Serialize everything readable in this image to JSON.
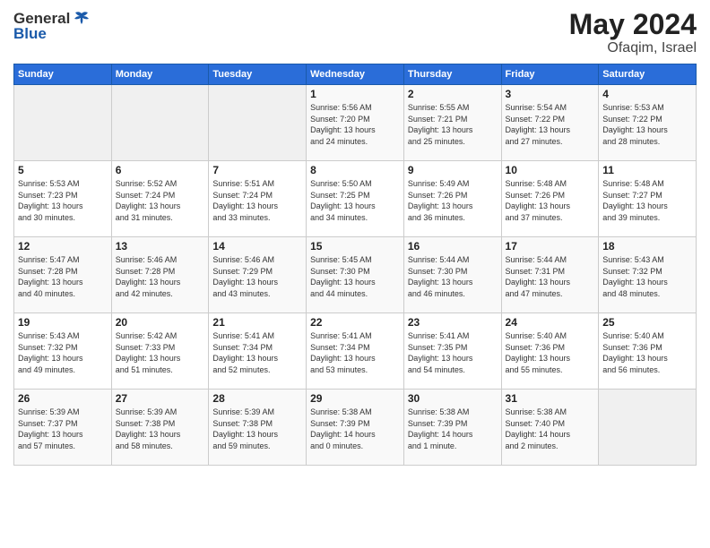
{
  "header": {
    "logo_general": "General",
    "logo_blue": "Blue",
    "month_year": "May 2024",
    "location": "Ofaqim, Israel"
  },
  "weekdays": [
    "Sunday",
    "Monday",
    "Tuesday",
    "Wednesday",
    "Thursday",
    "Friday",
    "Saturday"
  ],
  "weeks": [
    [
      {
        "day": "",
        "content": ""
      },
      {
        "day": "",
        "content": ""
      },
      {
        "day": "",
        "content": ""
      },
      {
        "day": "1",
        "content": "Sunrise: 5:56 AM\nSunset: 7:20 PM\nDaylight: 13 hours\nand 24 minutes."
      },
      {
        "day": "2",
        "content": "Sunrise: 5:55 AM\nSunset: 7:21 PM\nDaylight: 13 hours\nand 25 minutes."
      },
      {
        "day": "3",
        "content": "Sunrise: 5:54 AM\nSunset: 7:22 PM\nDaylight: 13 hours\nand 27 minutes."
      },
      {
        "day": "4",
        "content": "Sunrise: 5:53 AM\nSunset: 7:22 PM\nDaylight: 13 hours\nand 28 minutes."
      }
    ],
    [
      {
        "day": "5",
        "content": "Sunrise: 5:53 AM\nSunset: 7:23 PM\nDaylight: 13 hours\nand 30 minutes."
      },
      {
        "day": "6",
        "content": "Sunrise: 5:52 AM\nSunset: 7:24 PM\nDaylight: 13 hours\nand 31 minutes."
      },
      {
        "day": "7",
        "content": "Sunrise: 5:51 AM\nSunset: 7:24 PM\nDaylight: 13 hours\nand 33 minutes."
      },
      {
        "day": "8",
        "content": "Sunrise: 5:50 AM\nSunset: 7:25 PM\nDaylight: 13 hours\nand 34 minutes."
      },
      {
        "day": "9",
        "content": "Sunrise: 5:49 AM\nSunset: 7:26 PM\nDaylight: 13 hours\nand 36 minutes."
      },
      {
        "day": "10",
        "content": "Sunrise: 5:48 AM\nSunset: 7:26 PM\nDaylight: 13 hours\nand 37 minutes."
      },
      {
        "day": "11",
        "content": "Sunrise: 5:48 AM\nSunset: 7:27 PM\nDaylight: 13 hours\nand 39 minutes."
      }
    ],
    [
      {
        "day": "12",
        "content": "Sunrise: 5:47 AM\nSunset: 7:28 PM\nDaylight: 13 hours\nand 40 minutes."
      },
      {
        "day": "13",
        "content": "Sunrise: 5:46 AM\nSunset: 7:28 PM\nDaylight: 13 hours\nand 42 minutes."
      },
      {
        "day": "14",
        "content": "Sunrise: 5:46 AM\nSunset: 7:29 PM\nDaylight: 13 hours\nand 43 minutes."
      },
      {
        "day": "15",
        "content": "Sunrise: 5:45 AM\nSunset: 7:30 PM\nDaylight: 13 hours\nand 44 minutes."
      },
      {
        "day": "16",
        "content": "Sunrise: 5:44 AM\nSunset: 7:30 PM\nDaylight: 13 hours\nand 46 minutes."
      },
      {
        "day": "17",
        "content": "Sunrise: 5:44 AM\nSunset: 7:31 PM\nDaylight: 13 hours\nand 47 minutes."
      },
      {
        "day": "18",
        "content": "Sunrise: 5:43 AM\nSunset: 7:32 PM\nDaylight: 13 hours\nand 48 minutes."
      }
    ],
    [
      {
        "day": "19",
        "content": "Sunrise: 5:43 AM\nSunset: 7:32 PM\nDaylight: 13 hours\nand 49 minutes."
      },
      {
        "day": "20",
        "content": "Sunrise: 5:42 AM\nSunset: 7:33 PM\nDaylight: 13 hours\nand 51 minutes."
      },
      {
        "day": "21",
        "content": "Sunrise: 5:41 AM\nSunset: 7:34 PM\nDaylight: 13 hours\nand 52 minutes."
      },
      {
        "day": "22",
        "content": "Sunrise: 5:41 AM\nSunset: 7:34 PM\nDaylight: 13 hours\nand 53 minutes."
      },
      {
        "day": "23",
        "content": "Sunrise: 5:41 AM\nSunset: 7:35 PM\nDaylight: 13 hours\nand 54 minutes."
      },
      {
        "day": "24",
        "content": "Sunrise: 5:40 AM\nSunset: 7:36 PM\nDaylight: 13 hours\nand 55 minutes."
      },
      {
        "day": "25",
        "content": "Sunrise: 5:40 AM\nSunset: 7:36 PM\nDaylight: 13 hours\nand 56 minutes."
      }
    ],
    [
      {
        "day": "26",
        "content": "Sunrise: 5:39 AM\nSunset: 7:37 PM\nDaylight: 13 hours\nand 57 minutes."
      },
      {
        "day": "27",
        "content": "Sunrise: 5:39 AM\nSunset: 7:38 PM\nDaylight: 13 hours\nand 58 minutes."
      },
      {
        "day": "28",
        "content": "Sunrise: 5:39 AM\nSunset: 7:38 PM\nDaylight: 13 hours\nand 59 minutes."
      },
      {
        "day": "29",
        "content": "Sunrise: 5:38 AM\nSunset: 7:39 PM\nDaylight: 14 hours\nand 0 minutes."
      },
      {
        "day": "30",
        "content": "Sunrise: 5:38 AM\nSunset: 7:39 PM\nDaylight: 14 hours\nand 1 minute."
      },
      {
        "day": "31",
        "content": "Sunrise: 5:38 AM\nSunset: 7:40 PM\nDaylight: 14 hours\nand 2 minutes."
      },
      {
        "day": "",
        "content": ""
      }
    ]
  ]
}
